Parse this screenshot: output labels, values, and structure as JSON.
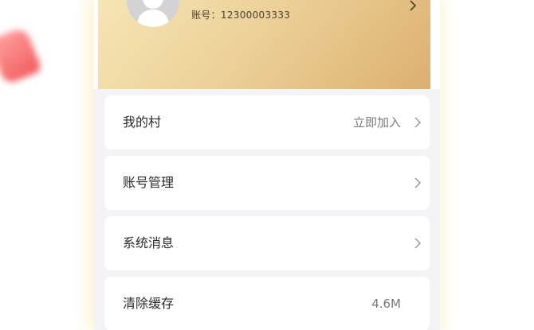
{
  "profile": {
    "account_label": "账号：",
    "account_number": "12300003333"
  },
  "menu": [
    {
      "label": "我的村",
      "value": "立即加入",
      "has_chevron": true
    },
    {
      "label": "账号管理",
      "value": "",
      "has_chevron": true
    },
    {
      "label": "系统消息",
      "value": "",
      "has_chevron": true
    },
    {
      "label": "清除缓存",
      "value": "4.6M",
      "has_chevron": false
    }
  ],
  "colors": {
    "header_gold_start": "#f6e5b4",
    "header_gold_end": "#dcb06f",
    "page_background": "#f3f3f5",
    "card_background": "#ffffff"
  },
  "icons": {
    "avatar": "default-user-avatar-icon",
    "chevron": "chevron-right-icon"
  }
}
